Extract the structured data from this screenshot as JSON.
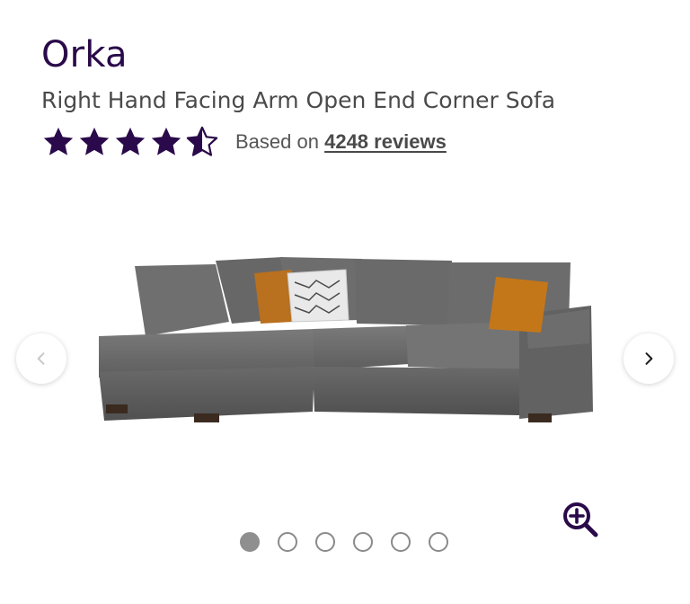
{
  "product": {
    "name": "Orka",
    "subtitle": "Right Hand Facing Arm Open End Corner Sofa"
  },
  "rating": {
    "value": 4.5,
    "max": 5,
    "based_on_label": "Based on",
    "reviews_label": "4248 reviews"
  },
  "gallery": {
    "image_alt": "Grey corner sofa with cushions",
    "total_images": 6,
    "active_index": 0,
    "icons": {
      "prev": "chevron-left-icon",
      "next": "chevron-right-icon",
      "zoom": "zoom-in-icon"
    }
  },
  "colors": {
    "brand": "#2a0a4a",
    "sofa": "#6b6b6b",
    "cushion_orange": "#c8781c",
    "dot_active": "#8f8f8f"
  }
}
